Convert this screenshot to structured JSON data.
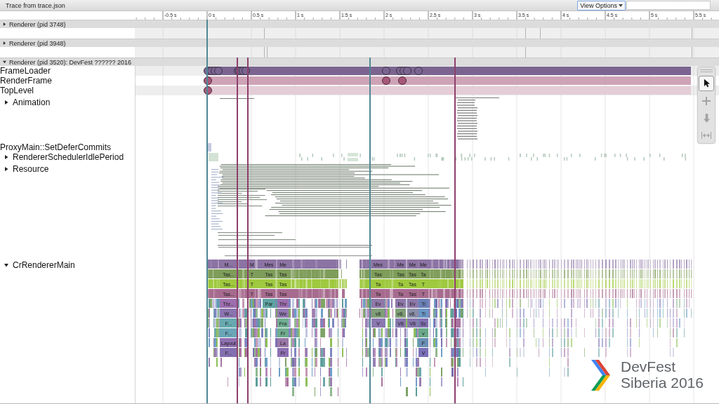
{
  "window": {
    "title": "Trace from trace.json"
  },
  "toolbar": {
    "view_options": "View Options"
  },
  "ruler": {
    "ticks": [
      "-0.5 s",
      "0 s",
      "0.5 s",
      "1 s",
      "1.5 s",
      "2 s",
      "2.5 s",
      "3 s",
      "3.5 s",
      "4 s",
      "4.5 s",
      "5 s",
      "5.5 s"
    ]
  },
  "processes": [
    {
      "title": "Renderer (pid 3748)",
      "expanded": false
    },
    {
      "title": "Renderer (pid 3948)",
      "expanded": false
    },
    {
      "title": "Renderer (pid 3520): DevFest ?????? 2016",
      "expanded": true,
      "tracks": [
        {
          "kind": "object",
          "label": "FrameLoader",
          "color": "#7b6590"
        },
        {
          "kind": "object",
          "label": "RenderFrame",
          "color": "#a6587a"
        },
        {
          "kind": "object",
          "label": "TopLevel",
          "color": "#a6587a"
        },
        {
          "kind": "async",
          "label": "Animation",
          "expanded": false
        },
        {
          "kind": "slice",
          "label": "ProxyMain::SetDeferCommits"
        },
        {
          "kind": "async",
          "label": "RendererSchedulerIdlePeriod",
          "expanded": false
        },
        {
          "kind": "async",
          "label": "Resource",
          "expanded": false
        },
        {
          "kind": "thread",
          "label": "CrRendererMain",
          "expanded": true,
          "stacks": [
            {
              "slices": [
                {
                  "label": "M...",
                  "color": "#8b73a3"
                },
                {
                  "label": "Tas...",
                  "color": "#7f9d5a"
                },
                {
                  "label": "Tas...",
                  "color": "#9fc93f"
                },
                {
                  "label": "Tas...",
                  "color": "#a66b8e"
                },
                {
                  "label": "Thr...",
                  "color": "#9c6fae"
                },
                {
                  "label": "W...",
                  "color": "#8a74ae"
                },
                {
                  "label": "F...",
                  "color": "#67a9b0"
                },
                {
                  "label": "F...",
                  "color": "#6aa6b8"
                },
                {
                  "label": "Layout",
                  "color": "#9070b0"
                },
                {
                  "label": "F...",
                  "color": "#8470b0"
                }
              ]
            },
            {
              "slices": [
                {
                  "label": "M",
                  "color": "#8b73a3"
                },
                {
                  "label": "T",
                  "color": "#7f9d5a"
                },
                {
                  "label": "T",
                  "color": "#9fc93f"
                },
                {
                  "label": "T",
                  "color": "#a66b8e"
                }
              ]
            },
            {
              "slices": [
                {
                  "label": "Mes",
                  "color": "#8b73a3"
                },
                {
                  "label": "Tas",
                  "color": "#7f9d5a"
                },
                {
                  "label": "Tas",
                  "color": "#9fc93f"
                },
                {
                  "label": "Tas",
                  "color": "#a66b8e"
                },
                {
                  "label": "Par",
                  "color": "#5fa3a3"
                }
              ]
            },
            {
              "slices": [
                {
                  "label": "Me",
                  "color": "#8b73a3"
                },
                {
                  "label": "Tas",
                  "color": "#7f9d5a"
                },
                {
                  "label": "Tas",
                  "color": "#9fc93f"
                },
                {
                  "label": "Tas",
                  "color": "#a66b8e"
                },
                {
                  "label": "Thr",
                  "color": "#9c6fae"
                },
                {
                  "label": "We",
                  "color": "#9278b0"
                },
                {
                  "label": "Fra",
                  "color": "#6fae92"
                },
                {
                  "label": "Fr",
                  "color": "#70ac8e"
                },
                {
                  "label": "La",
                  "color": "#9a78a8"
                },
                {
                  "label": "Fr",
                  "color": "#8c70b0"
                }
              ]
            },
            {
              "slices": [
                {
                  "label": "Mes",
                  "color": "#8b73a3"
                },
                {
                  "label": "Tas",
                  "color": "#7f9d5a"
                },
                {
                  "label": "Ta",
                  "color": "#9fc93f"
                },
                {
                  "label": "Ta",
                  "color": "#a66b8e"
                },
                {
                  "label": "Ev",
                  "color": "#8f78a8"
                },
                {
                  "label": "v8",
                  "color": "#7f9e78"
                },
                {
                  "label": "V",
                  "color": "#8a78b0"
                }
              ]
            },
            {
              "slices": [
                {
                  "label": "Me",
                  "color": "#8b73a3"
                },
                {
                  "label": "Tas",
                  "color": "#7f9d5a"
                },
                {
                  "label": "Ta",
                  "color": "#9fc93f"
                },
                {
                  "label": "Ta",
                  "color": "#a66b8e"
                },
                {
                  "label": "Ev",
                  "color": "#8f78a8"
                },
                {
                  "label": "v8.",
                  "color": "#7f9e78"
                },
                {
                  "label": "V8",
                  "color": "#8878b0"
                }
              ]
            },
            {
              "slices": [
                {
                  "label": "Me",
                  "color": "#8b73a3"
                },
                {
                  "label": "Tas",
                  "color": "#7f9d5a"
                },
                {
                  "label": "Tas",
                  "color": "#9fc93f"
                },
                {
                  "label": "Tas",
                  "color": "#a66b8e"
                },
                {
                  "label": "Ev",
                  "color": "#8f78a8"
                },
                {
                  "label": "v8.",
                  "color": "#8a8fa8"
                },
                {
                  "label": "V8",
                  "color": "#8878b0"
                }
              ]
            },
            {
              "slices": [
                {
                  "label": "Me",
                  "color": "#8b73a3"
                },
                {
                  "label": "Ta",
                  "color": "#7f9d5a"
                },
                {
                  "label": "T",
                  "color": "#9fc93f"
                },
                {
                  "label": "T",
                  "color": "#a66b8e"
                },
                {
                  "label": "Ti",
                  "color": "#6b7fb5"
                },
                {
                  "label": "Ti",
                  "color": "#6a96c4"
                },
                {
                  "label": "Sc",
                  "color": "#8070b0"
                },
                {
                  "label": "v",
                  "color": "#6aa88a"
                },
                {
                  "label": "F",
                  "color": "#6a8fb5"
                },
                {
                  "label": "V",
                  "color": "#7a70b8"
                }
              ]
            }
          ]
        }
      ]
    }
  ],
  "tools": [
    {
      "selected": true
    },
    {
      "selected": false
    },
    {
      "selected": false
    },
    {
      "selected": false
    }
  ],
  "logo": {
    "title": "DevFest",
    "subtitle": "Siberia 2016"
  }
}
